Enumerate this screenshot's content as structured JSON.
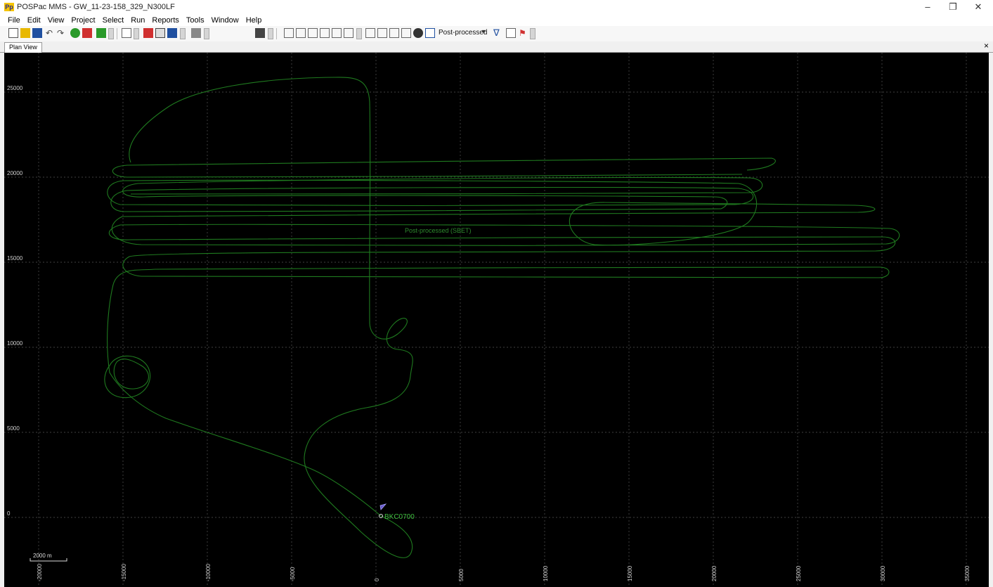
{
  "window": {
    "title": "POSPac MMS - GW_11-23-158_329_N300LF",
    "logo_text": "Pp",
    "minimize": "–",
    "restore": "❐",
    "close": "✕"
  },
  "menu": [
    "File",
    "Edit",
    "View",
    "Project",
    "Select",
    "Run",
    "Reports",
    "Tools",
    "Window",
    "Help"
  ],
  "toolbar": {
    "mode_value": "Post-processed",
    "accent_colors": {
      "red": "#d03030",
      "blue": "#2060c0",
      "green": "#2a9a2a",
      "yellow": "#e8b800"
    }
  },
  "tabs": {
    "active": "Plan View",
    "close": "×"
  },
  "plan": {
    "x_ticks": [
      "-20000",
      "-15000",
      "-10000",
      "-5000",
      "0",
      "5000",
      "10000",
      "15000",
      "20000",
      "25000",
      "30000",
      "35000"
    ],
    "y_ticks": [
      "25000",
      "20000",
      "15000",
      "10000",
      "5000",
      "0"
    ],
    "trajectory_label": "Post-processed (SBET)",
    "station_label": "BKC0700",
    "scale_label": "2000 m",
    "colors": {
      "trajectory": "#1f7a1f",
      "label": "#3fbf3f",
      "grid": "#555555",
      "axis_text": "#cfcfcf",
      "background": "#000000"
    }
  }
}
